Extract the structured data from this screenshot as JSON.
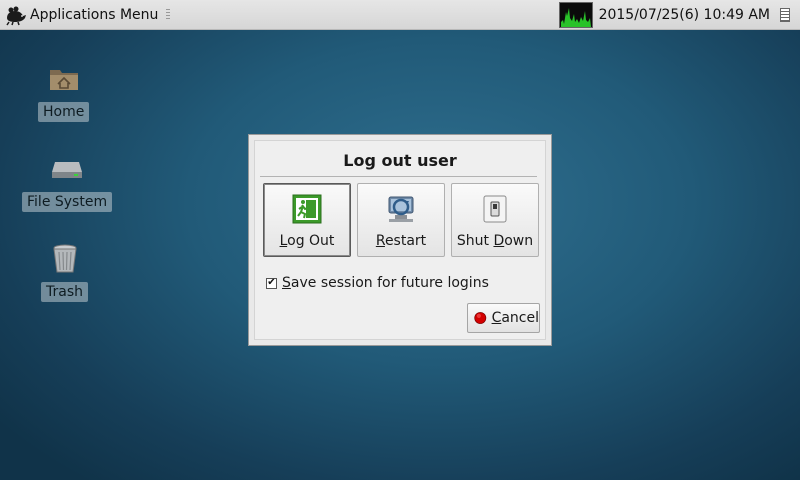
{
  "panel": {
    "app_menu_label": "Applications Menu",
    "clock": "2015/07/25(6) 10:49 AM"
  },
  "desktop": {
    "icons": [
      {
        "label": "Home",
        "icon": "home-folder-icon"
      },
      {
        "label": "File System",
        "icon": "drive-icon"
      },
      {
        "label": "Trash",
        "icon": "trash-icon"
      }
    ]
  },
  "dialog": {
    "title": "Log out user",
    "actions": [
      {
        "pre": "",
        "mnemonic": "L",
        "post": "og Out",
        "icon": "exit-door-icon"
      },
      {
        "pre": "",
        "mnemonic": "R",
        "post": "estart",
        "icon": "restart-icon"
      },
      {
        "pre": "Shut ",
        "mnemonic": "D",
        "post": "own",
        "icon": "power-switch-icon"
      }
    ],
    "save_session": {
      "checked": true,
      "mnemonic": "S",
      "post": "ave session for future logins"
    },
    "cancel": {
      "mnemonic": "C",
      "post": "ancel",
      "icon": "stop-icon"
    }
  },
  "colors": {
    "desktop": "#215a78",
    "panel": "#dcdcdc",
    "dialog": "#efefef",
    "cancel_icon": "#d40000",
    "exit_icon": "#3c9a2a"
  }
}
